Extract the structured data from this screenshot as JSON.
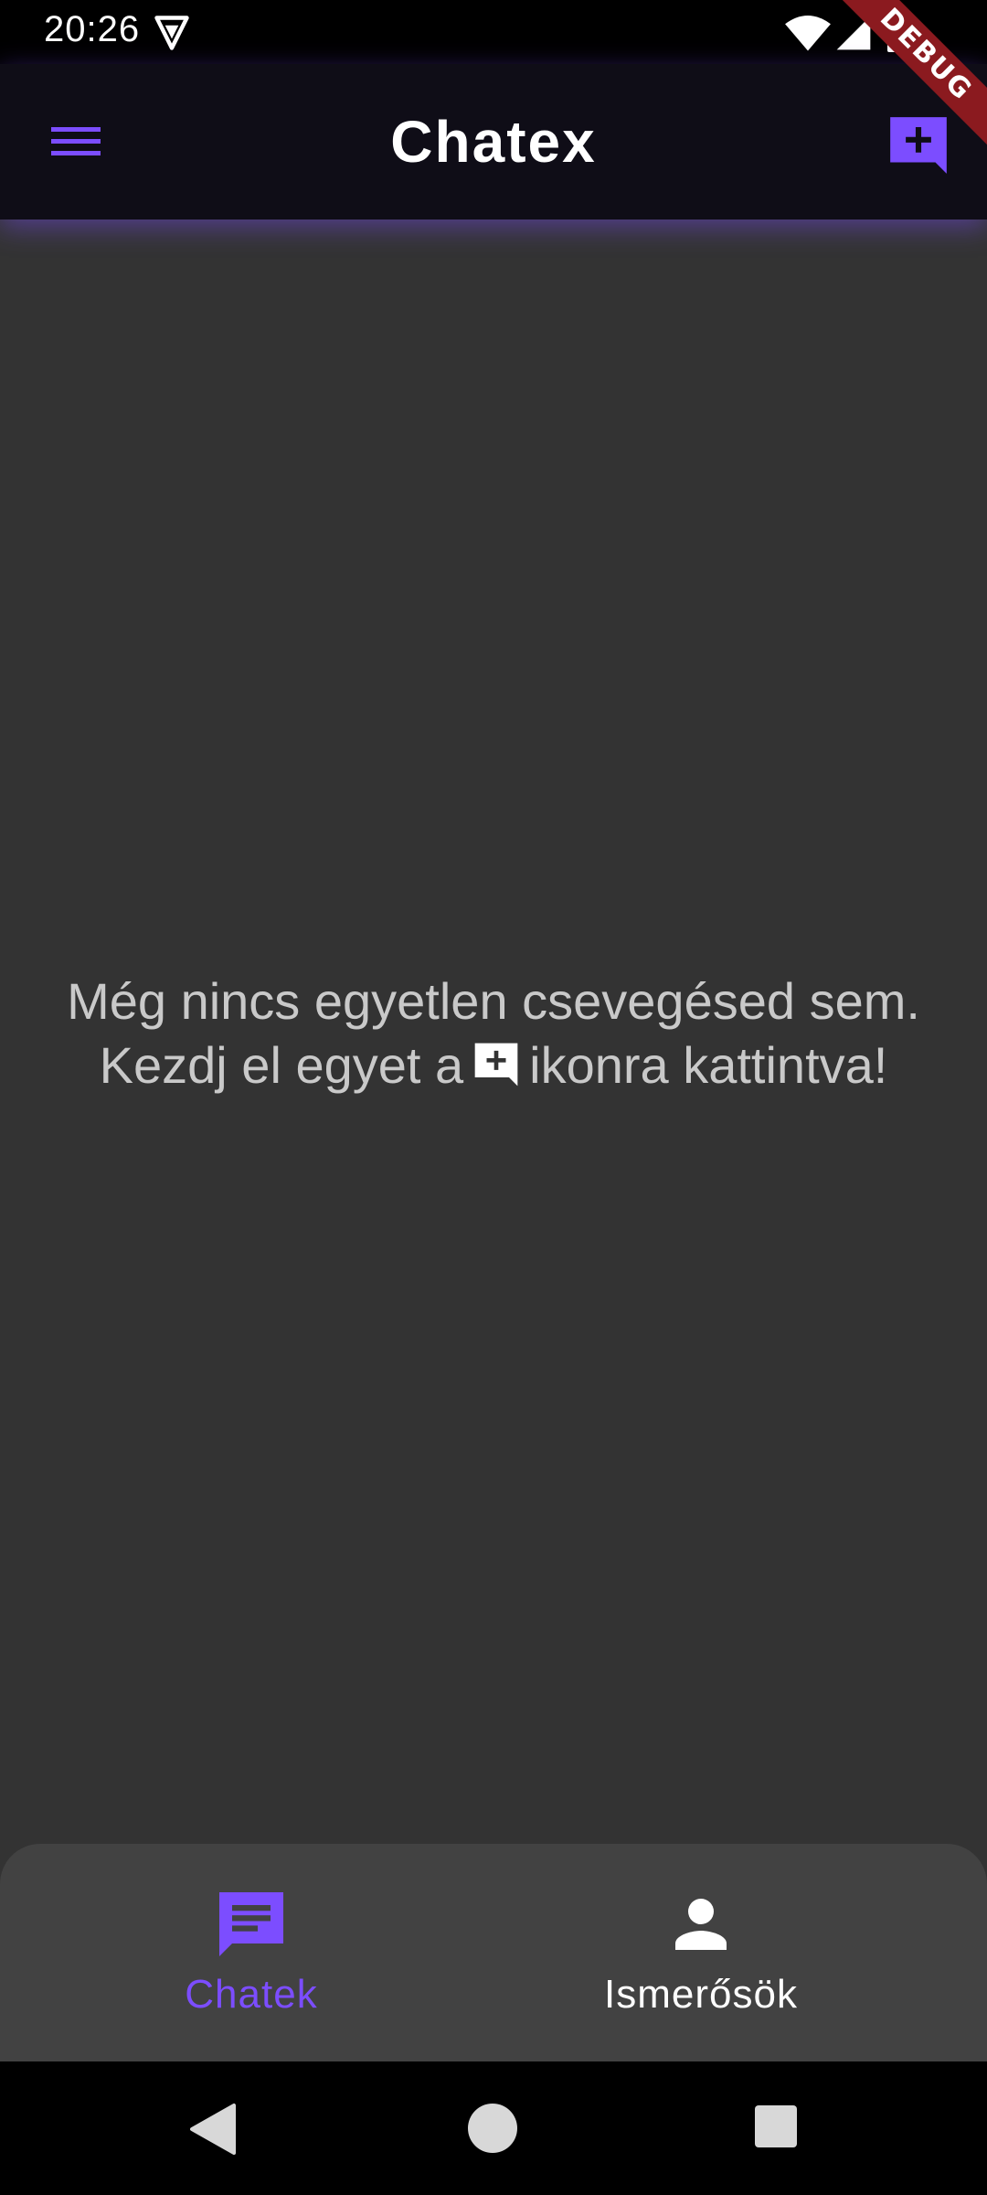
{
  "status_bar": {
    "time": "20:26",
    "icons": [
      "vpn-icon",
      "wifi-icon",
      "signal-icon",
      "battery-icon"
    ]
  },
  "debug_banner": "DEBUG",
  "app_bar": {
    "title": "Chatex",
    "menu_icon": "menu-icon",
    "action_icon": "add-comment-icon"
  },
  "main": {
    "empty_line1": "Még nincs egyetlen csevegésed sem.",
    "empty_line2_before": "Kezdj el egyet a",
    "empty_line2_after": "ikonra kattintva!"
  },
  "bottom_nav": {
    "items": [
      {
        "label": "Chatek",
        "icon": "chat-icon",
        "selected": true
      },
      {
        "label": "Ismerősök",
        "icon": "person-icon",
        "selected": false
      }
    ]
  },
  "colors": {
    "accent": "#7c4dff",
    "app_bar_bg": "#0f0d17",
    "body_bg": "#333333",
    "bottom_nav_bg": "#424242",
    "debug_ribbon": "#8b1a1f"
  }
}
